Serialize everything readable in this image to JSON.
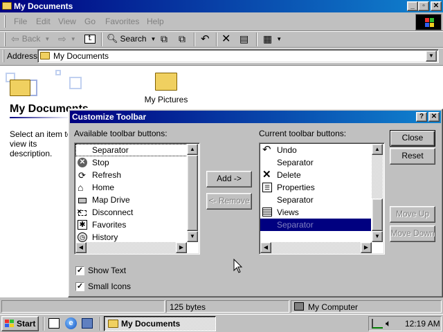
{
  "window": {
    "title": "My Documents"
  },
  "menu": [
    "File",
    "Edit",
    "View",
    "Go",
    "Favorites",
    "Help"
  ],
  "toolbar": {
    "back": "Back",
    "search": "Search"
  },
  "address": {
    "label": "Address",
    "value": "My Documents"
  },
  "content": {
    "folder_title": "My Documents",
    "hint": "Select an item to view its description.",
    "items": [
      {
        "label": "My Pictures"
      }
    ]
  },
  "dialog": {
    "title": "Customize Toolbar",
    "available_label": "Available toolbar buttons:",
    "current_label": "Current toolbar buttons:",
    "available": [
      {
        "label": "Separator",
        "icon": "separator"
      },
      {
        "label": "Stop",
        "icon": "stop-icon"
      },
      {
        "label": "Refresh",
        "icon": "refresh-icon"
      },
      {
        "label": "Home",
        "icon": "home-icon"
      },
      {
        "label": "Map Drive",
        "icon": "map-drive-icon"
      },
      {
        "label": "Disconnect",
        "icon": "disconnect-icon"
      },
      {
        "label": "Favorites",
        "icon": "favorites-icon"
      },
      {
        "label": "History",
        "icon": "history-icon"
      }
    ],
    "current": [
      {
        "label": "Undo",
        "icon": "undo-icon"
      },
      {
        "label": "Separator",
        "icon": "separator"
      },
      {
        "label": "Delete",
        "icon": "delete-icon"
      },
      {
        "label": "Properties",
        "icon": "properties-icon"
      },
      {
        "label": "Separator",
        "icon": "separator"
      },
      {
        "label": "Views",
        "icon": "views-icon"
      },
      {
        "label": "Separator",
        "icon": "separator",
        "selected": true
      }
    ],
    "buttons": {
      "add": "Add ->",
      "remove": "<- Remove",
      "close": "Close",
      "reset": "Reset",
      "move_up": "Move Up",
      "move_down": "Move Down"
    },
    "show_text": {
      "label": "Show Text",
      "checked": true
    },
    "small_icons": {
      "label": "Small Icons",
      "checked": true
    }
  },
  "status": {
    "size": "125 bytes",
    "zone": "My Computer"
  },
  "taskbar": {
    "start": "Start",
    "task": "My Documents",
    "clock": "12:19 AM"
  },
  "colors": {
    "titlebar": "#000080",
    "desktop": "#c0c0c0",
    "selection": "#000080"
  }
}
